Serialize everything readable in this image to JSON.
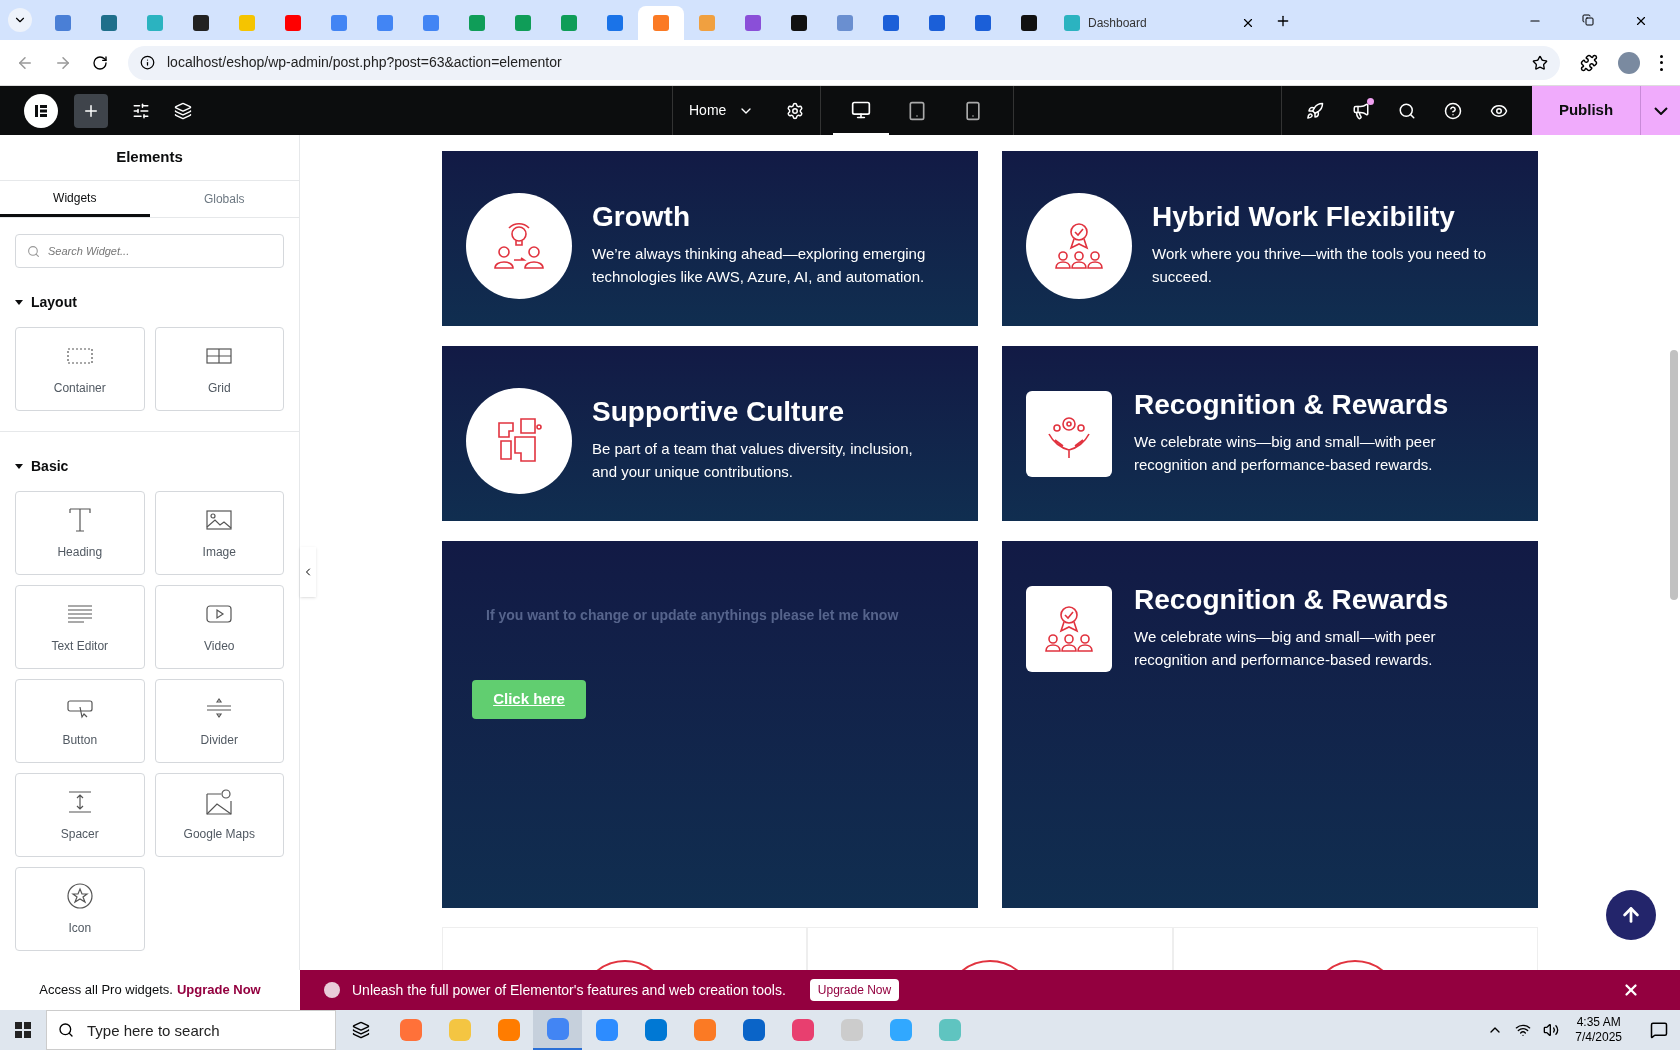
{
  "browser": {
    "tabs": [
      {
        "color": "#4a7fd6",
        "selected": false
      },
      {
        "color": "#1f6f8b",
        "selected": false
      },
      {
        "color": "#2bb3c0",
        "selected": false
      },
      {
        "color": "#222222",
        "selected": false
      },
      {
        "color": "#f5c400",
        "selected": false
      },
      {
        "color": "#ff0000",
        "selected": false
      },
      {
        "color": "#4285f4",
        "selected": false
      },
      {
        "color": "#4285f4",
        "selected": false
      },
      {
        "color": "#4285f4",
        "selected": false
      },
      {
        "color": "#0f9d58",
        "selected": false
      },
      {
        "color": "#0f9d58",
        "selected": false
      },
      {
        "color": "#0f9d58",
        "selected": false
      },
      {
        "color": "#1a73e8",
        "selected": false
      },
      {
        "color": "#fb7a24",
        "selected": true
      },
      {
        "color": "#f0a040",
        "selected": false
      },
      {
        "color": "#8a4fd8",
        "selected": false
      },
      {
        "color": "#111111",
        "selected": false
      },
      {
        "color": "#6a8fd0",
        "selected": false
      },
      {
        "color": "#1b5fd8",
        "selected": false
      },
      {
        "color": "#1b5fd8",
        "selected": false
      },
      {
        "color": "#1b5fd8",
        "selected": false
      },
      {
        "color": "#111111",
        "selected": false
      },
      {
        "color": "#2bb3c0",
        "selected": false,
        "title": "Dashboard"
      }
    ],
    "address": "localhost/eshop/wp-admin/post.php?post=63&action=elementor"
  },
  "editor_bar": {
    "page": "Home",
    "devices": [
      {
        "selected": true
      },
      {
        "selected": false
      },
      {
        "selected": false
      }
    ],
    "publish": "Publish"
  },
  "panel": {
    "title": "Elements",
    "tabs": [
      {
        "label": "Widgets",
        "selected": true
      },
      {
        "label": "Globals",
        "selected": false
      }
    ],
    "search": {
      "placeholder": "Search Widget..."
    },
    "sections": [
      {
        "title": "Layout",
        "expanded": true,
        "widgets": [
          {
            "label": "Container",
            "kind": "container"
          },
          {
            "label": "Grid",
            "kind": "grid"
          }
        ]
      },
      {
        "title": "Basic",
        "expanded": true,
        "widgets": [
          {
            "label": "Heading",
            "kind": "heading"
          },
          {
            "label": "Image",
            "kind": "image"
          },
          {
            "label": "Text Editor",
            "kind": "text"
          },
          {
            "label": "Video",
            "kind": "video"
          },
          {
            "label": "Button",
            "kind": "button"
          },
          {
            "label": "Divider",
            "kind": "divider"
          },
          {
            "label": "Spacer",
            "kind": "spacer"
          },
          {
            "label": "Google Maps",
            "kind": "map"
          },
          {
            "label": "Icon",
            "kind": "icon"
          }
        ]
      }
    ]
  },
  "cards": [
    {
      "kind": "circle",
      "title": "Growth",
      "text": "We’re always thinking ahead—exploring emerging technologies like AWS, Azure, AI, and automation."
    },
    {
      "kind": "circle",
      "title": "Hybrid Work Flexibility",
      "text": "Work where you thrive—with the tools you need to succeed."
    },
    {
      "kind": "circle",
      "title": "Supportive Culture",
      "text": "Be part of a team that values diversity, inclusion, and your unique contributions."
    },
    {
      "kind": "square",
      "title": "Recognition & Rewards",
      "text": "We celebrate wins—big and small—with peer recognition and performance-based rewards."
    },
    {
      "kind": "cta",
      "note": "If you want to change or update anythings please let me know",
      "button": "Click here"
    },
    {
      "kind": "square",
      "title": "Recognition & Rewards",
      "text": "We celebrate wins—big and small—with peer recognition and performance-based rewards."
    }
  ],
  "promo": {
    "text": "Access all Pro widgets.",
    "link": "Upgrade Now"
  },
  "banner": {
    "text": "Unleash the full power of Elementor's features and web creation tools.",
    "button": "Upgrade Now"
  },
  "taskbar": {
    "search_placeholder": "Type here to search",
    "apps": [
      {
        "color": "#ff7139",
        "selected": false
      },
      {
        "color": "#f4c542",
        "selected": false
      },
      {
        "color": "#ff7c00",
        "selected": false
      },
      {
        "color": "#4285f4",
        "selected": true
      },
      {
        "color": "#2d8cff",
        "selected": false
      },
      {
        "color": "#0078d4",
        "selected": false
      },
      {
        "color": "#fb7a24",
        "selected": false
      },
      {
        "color": "#0a64c8",
        "selected": false
      },
      {
        "color": "#e83f6f",
        "selected": false
      },
      {
        "color": "#cccccc",
        "selected": false
      },
      {
        "color": "#31a8ff",
        "selected": false
      },
      {
        "color": "#5fc4c0",
        "selected": false
      }
    ],
    "time": "4:35 AM",
    "date": "7/4/2025"
  }
}
